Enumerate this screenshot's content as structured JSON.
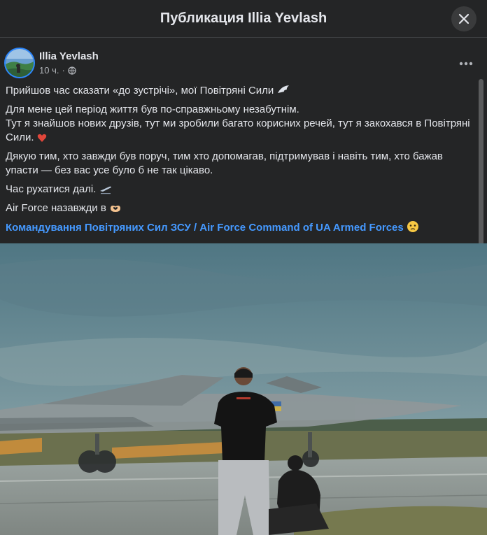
{
  "header": {
    "title": "Публикация Illia Yevlash"
  },
  "post": {
    "author": "Illia Yevlash",
    "time": "10 ч.",
    "separator": "·",
    "paragraphs": [
      "Прийшов час сказати «до зустрічі», мої Повітряні Сили",
      "Для мене цей період життя був по-справжньому незабутнім.",
      "Тут я знайшов нових друзів, тут ми зробили багато корисних речей, тут я закохався в Повітряні Сили.",
      "Дякую тим, хто завжди був поруч, тим хто допомагав, підтримував і навіть тим, хто бажав упасти — без вас усе було б не так цікаво.",
      "Час рухатися далі.",
      "Air Force назавжди в"
    ],
    "tag": "Командування Повітряних Сил ЗСУ / Air Force Command of UA Armed Forces"
  },
  "icons": {
    "close": "close-icon",
    "more": "more-options-icon",
    "privacy": "globe-icon"
  },
  "colors": {
    "background": "#242526",
    "link": "#4599ff",
    "text": "#e4e6eb",
    "muted": "#b0b3b8"
  }
}
